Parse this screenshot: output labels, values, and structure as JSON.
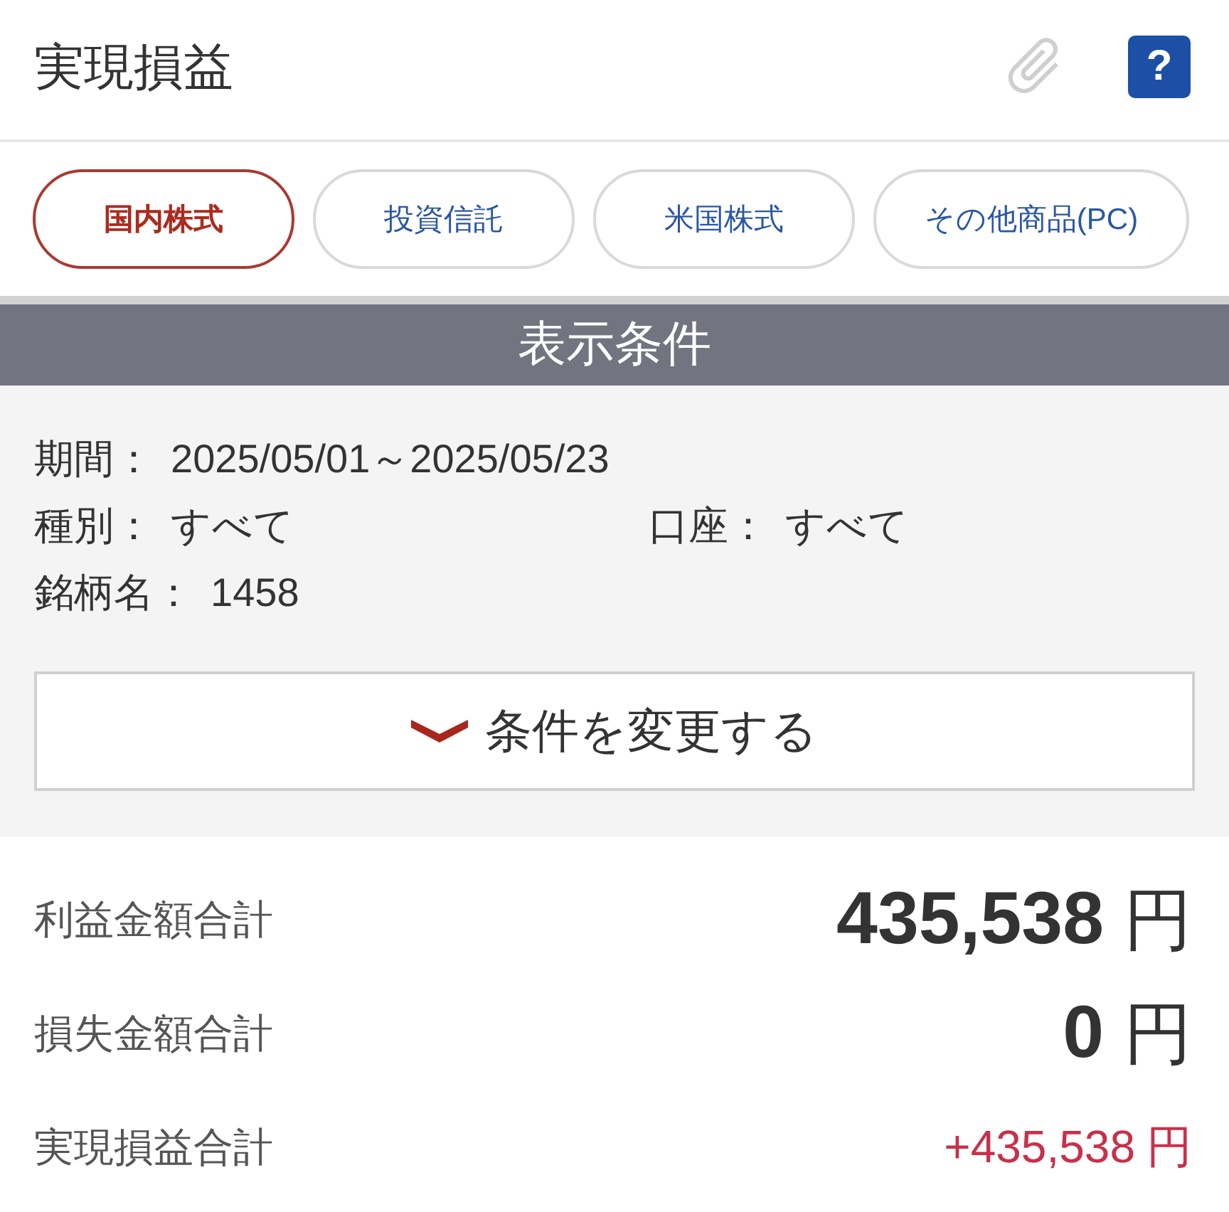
{
  "header": {
    "title": "実現損益",
    "help_label": "?"
  },
  "tabs": [
    {
      "label": "国内株式",
      "selected": true
    },
    {
      "label": "投資信託",
      "selected": false
    },
    {
      "label": "米国株式",
      "selected": false
    },
    {
      "label": "その他商品(PC)",
      "selected": false
    }
  ],
  "conditions": {
    "title": "表示条件",
    "rows": [
      {
        "fields": [
          {
            "label": "期間：",
            "value": "2025/05/01～2025/05/23"
          }
        ]
      },
      {
        "fields": [
          {
            "label": "種別：",
            "value": "すべて"
          },
          {
            "label": "口座：",
            "value": "すべて"
          }
        ]
      },
      {
        "fields": [
          {
            "label": "銘柄名：",
            "value": "1458"
          }
        ]
      }
    ],
    "change_button": "条件を変更する"
  },
  "summary": [
    {
      "label": "利益金額合計",
      "amount": "435,538",
      "unit": "円",
      "kind": "subtotal"
    },
    {
      "label": "損失金額合計",
      "amount": "0",
      "unit": "円",
      "kind": "subtotal"
    },
    {
      "label": "実現損益合計",
      "amount": "+435,538",
      "unit": "円",
      "kind": "net"
    }
  ]
}
